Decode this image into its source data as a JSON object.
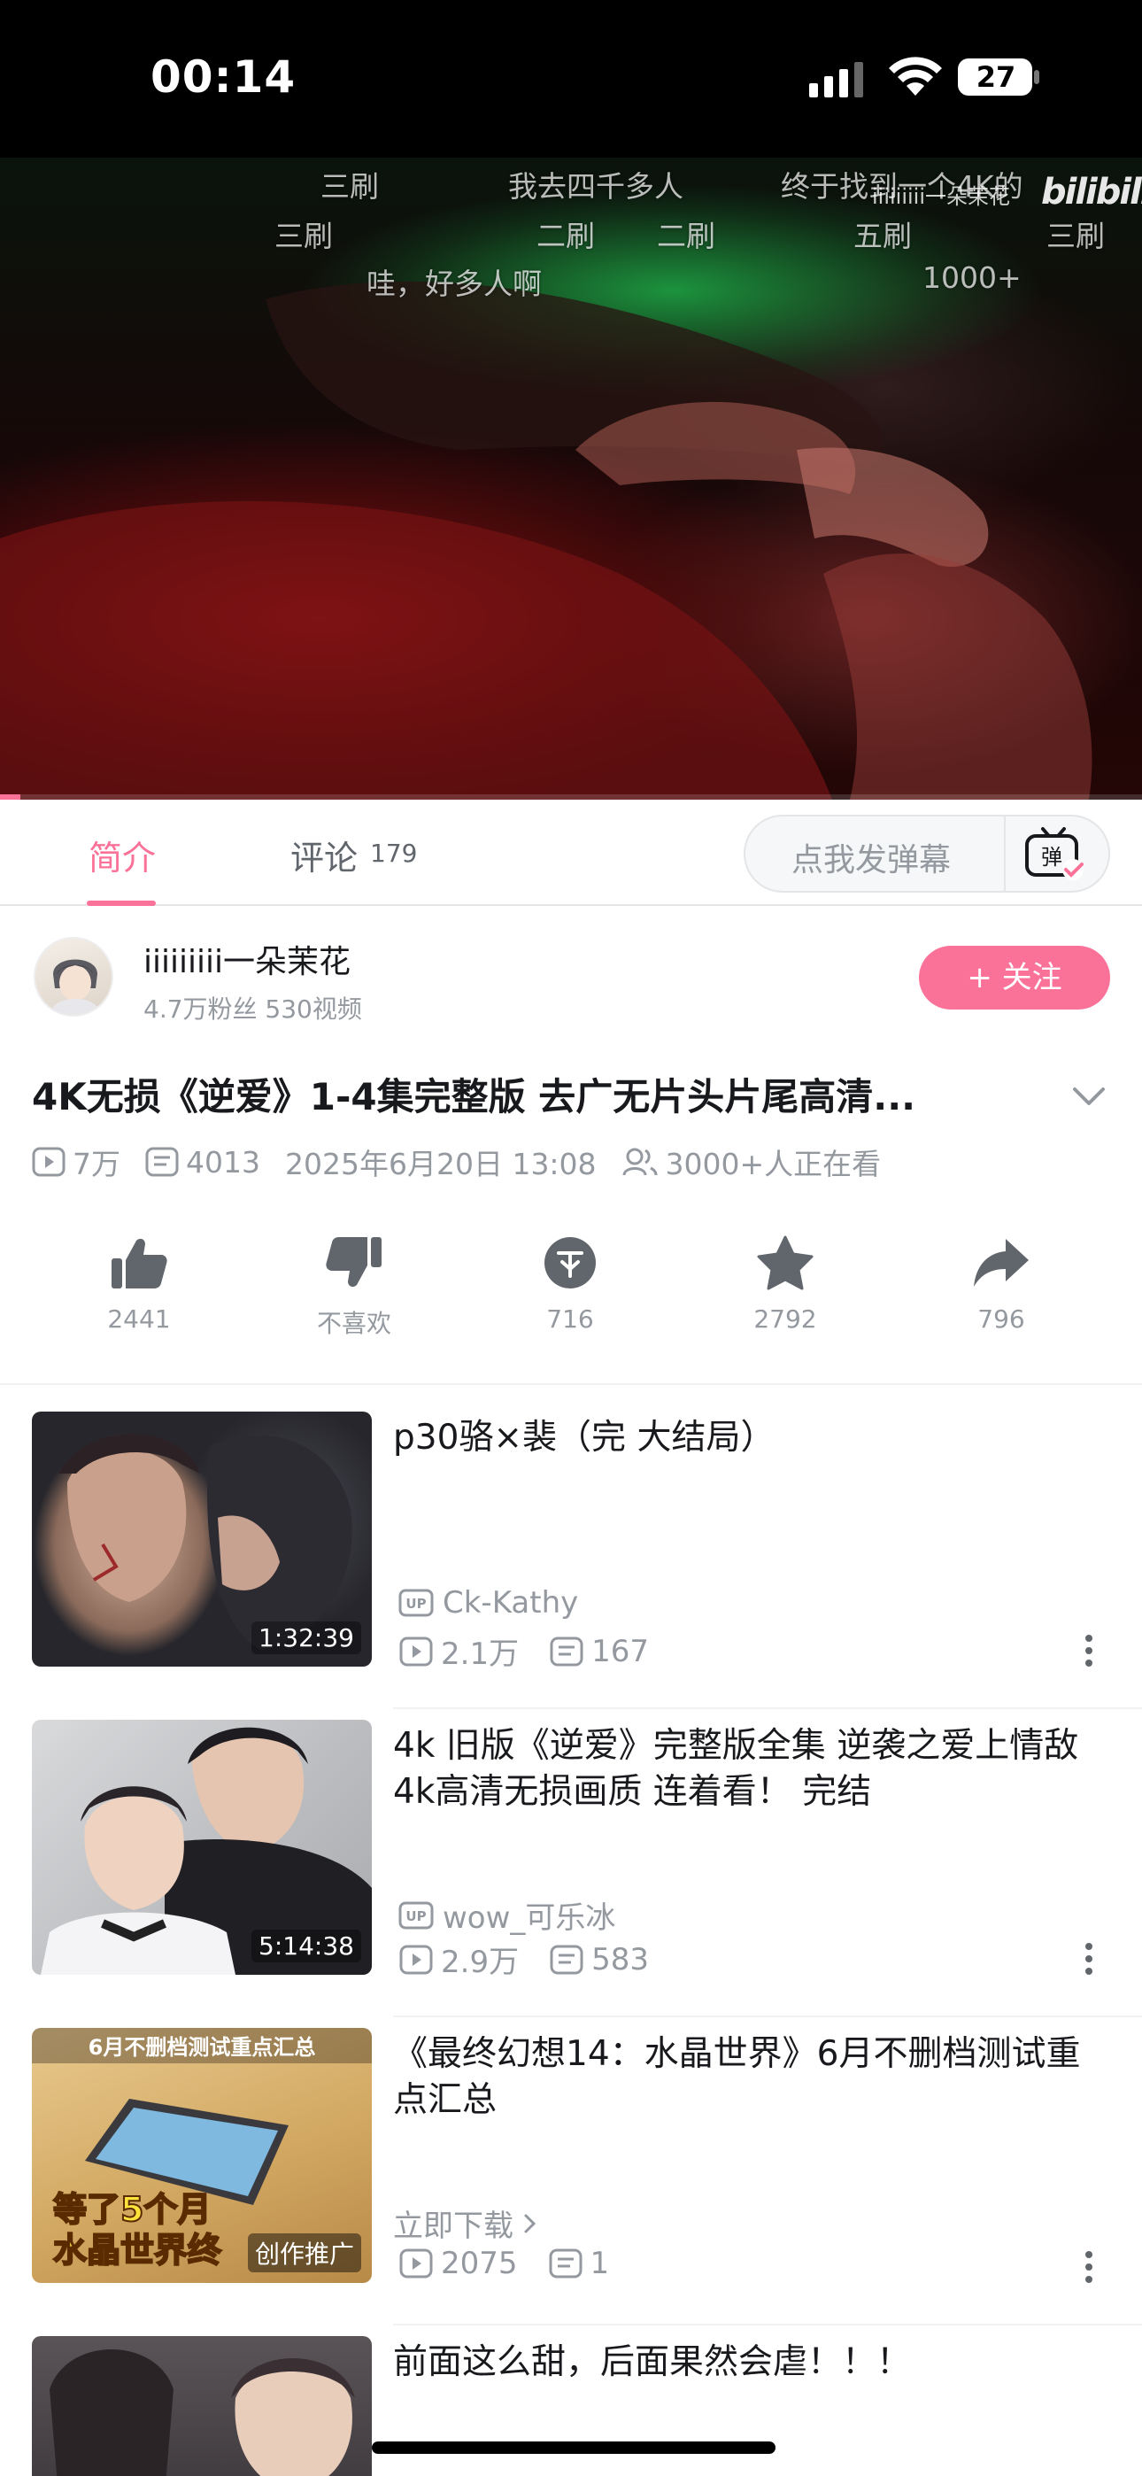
{
  "status_bar": {
    "time": "00:14",
    "battery": "27"
  },
  "player": {
    "danmaku": [
      "三刷",
      "我去四千多人",
      "终于找到一个4K的",
      "三刷",
      "二刷",
      "二刷",
      "五刷",
      "三刷",
      "哇，好多人啊",
      "1000+"
    ],
    "watermark": "iiiiiiiii一朵茉花",
    "logo": "bilibili",
    "progress": 0.018
  },
  "tabs": {
    "intro": "简介",
    "comments": "评论",
    "comment_count": "179"
  },
  "danmaku_input": {
    "placeholder": "点我发弹幕",
    "toggle_icon": "弹"
  },
  "uploader": {
    "name": "iiiiiiiii一朵茉花",
    "stats": "4.7万粉丝  530视频",
    "follow_label": "+ 关注"
  },
  "video": {
    "title": "4K无损《逆爱》1-4集完整版  去广无片头片尾高清...",
    "views": "7万",
    "danmaku_count": "4013",
    "date": "2025年6月20日 13:08",
    "watching": "3000+人正在看"
  },
  "actions": {
    "like": "2441",
    "dislike": "不喜欢",
    "coin": "716",
    "favorite": "2792",
    "share": "796"
  },
  "recommendations": [
    {
      "title": "p30骆×裴（完 大结局）",
      "up": "Ck-Kathy",
      "duration": "1:32:39",
      "views": "2.1万",
      "danmaku": "167"
    },
    {
      "title": "4k  旧版《逆爱》完整版全集  逆袭之爱上情敌  4k高清无损画质 连着看！ 完结",
      "up": "wow_可乐冰",
      "duration": "5:14:38",
      "views": "2.9万",
      "danmaku": "583"
    },
    {
      "title": "《最终幻想14：水晶世界》6月不删档测试重点汇总",
      "up": "立即下载",
      "tag": "创作推广",
      "thumb_top_text": "6月不删档测试重点汇总",
      "thumb_text_1": "等了5个月",
      "thumb_text_2": "水晶世界终",
      "views": "2075",
      "danmaku": "1"
    },
    {
      "title": "前面这么甜，后面果然会虐！！！"
    }
  ],
  "colors": {
    "accent": "#fb7299",
    "text": "#18191c",
    "secondary": "#9499a0"
  }
}
